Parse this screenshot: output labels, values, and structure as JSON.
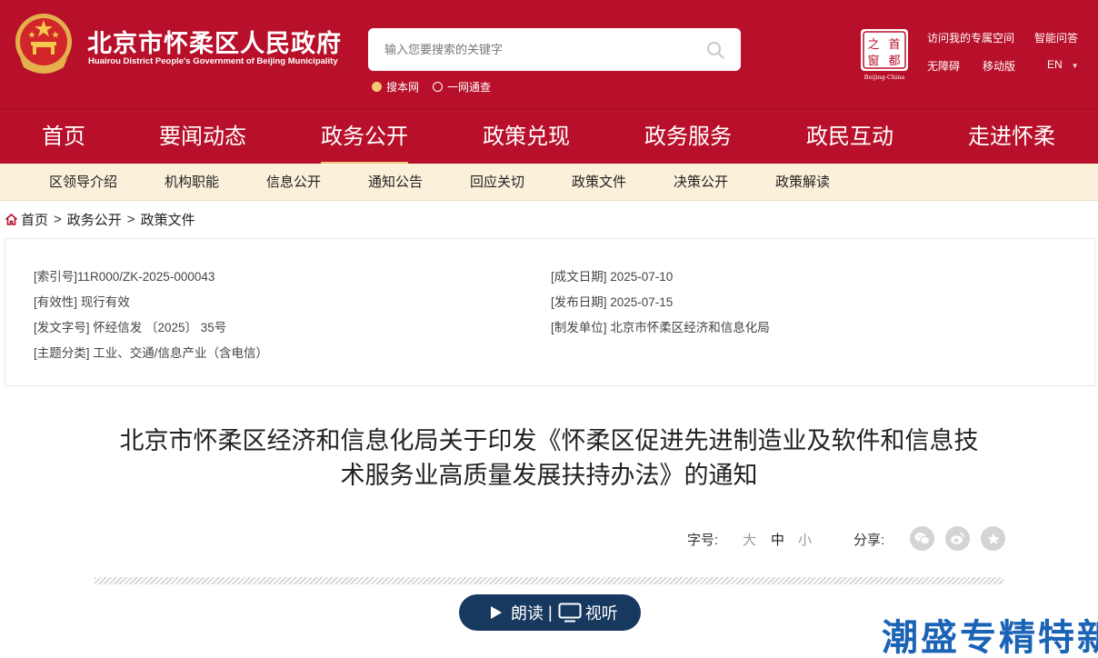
{
  "colors": {
    "primary_red": "#b8102a",
    "subnav_bg": "#fbf0d9",
    "audio_bar": "#17385f",
    "watermark_blue": "#1b63b5",
    "accent_gold": "#f4c57a"
  },
  "header": {
    "title": "北京市怀柔区人民政府",
    "subtitle": "Huairou District People's Government of Beijing Municipality",
    "search_placeholder": "输入您要搜索的关键字",
    "search_scopes": [
      {
        "label": "搜本网",
        "selected": true
      },
      {
        "label": "一网通查",
        "selected": false
      }
    ],
    "logo_chars": [
      "之",
      "首",
      "窗",
      "都"
    ],
    "logo_caption": "Beijing-China",
    "top_links": [
      "访问我的专属空间",
      "智能问答",
      "无障碍",
      "移动版",
      "EN"
    ]
  },
  "main_nav": [
    "首页",
    "要闻动态",
    "政务公开",
    "政策兑现",
    "政务服务",
    "政民互动",
    "走进怀柔"
  ],
  "main_nav_active": "政务公开",
  "sub_nav": [
    "区领导介绍",
    "机构职能",
    "信息公开",
    "通知公告",
    "回应关切",
    "政策文件",
    "决策公开",
    "政策解读"
  ],
  "breadcrumb": {
    "home": "首页",
    "sep": ">",
    "level1": "政务公开",
    "level2": "政策文件"
  },
  "meta": {
    "index_no": "[索引号]11R000/ZK-2025-000043",
    "validity": "[有效性] 现行有效",
    "doc_no": "[发文字号] 怀经信发 〔2025〕 35号",
    "topic": "[主题分类] 工业、交通/信息产业（含电信）",
    "created": "[成文日期] 2025-07-10",
    "published": "[发布日期] 2025-07-15",
    "issuer": "[制发单位] 北京市怀柔区经济和信息化局"
  },
  "title": "北京市怀柔区经济和信息化局关于印发《怀柔区促进先进制造业及软件和信息技术服务业高质量发展扶持办法》的通知",
  "title_line1": "北京市怀柔区经济和信息化局关于印发《怀柔区促进先进制造业及软件和信息技",
  "title_line2": "术服务业高质量发展扶持办法》的通知",
  "tools": {
    "font_size_label": "字号:",
    "font_sizes": [
      "大",
      "中",
      "小"
    ],
    "share_label": "分享:",
    "share_icons": [
      "wechat-icon",
      "weibo-icon",
      "favorite-icon"
    ]
  },
  "audio": {
    "read": "朗读",
    "separator": "|",
    "watch": "视听"
  },
  "watermark": "潮盛专精特新"
}
